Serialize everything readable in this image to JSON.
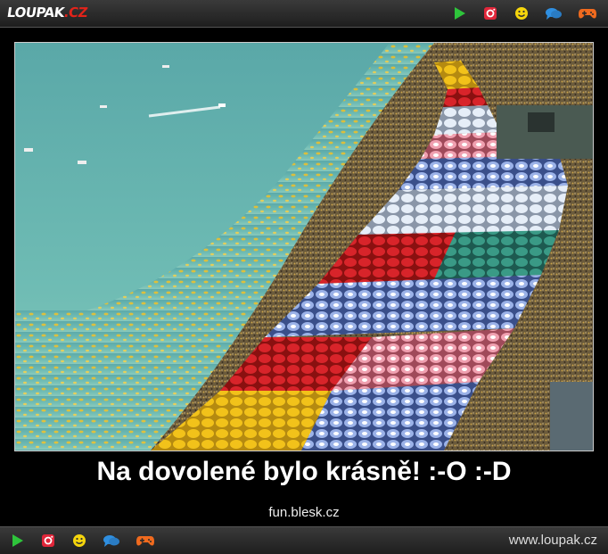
{
  "header": {
    "logo_main": "LOUPAK",
    "logo_suffix": ".CZ",
    "icons": [
      "play-icon",
      "instagram-icon",
      "smiley-icon",
      "chat-bubbles-icon",
      "gamepad-icon"
    ]
  },
  "content": {
    "caption": "Na dovolené bylo krásně! :-O :-D",
    "source": "fun.blesk.cz",
    "image_description": "aerial photo of a crowded beach with rows of colorful umbrellas"
  },
  "footer": {
    "site": "www.loupak.cz",
    "icons": [
      "play-icon",
      "instagram-icon",
      "smiley-icon",
      "chat-bubbles-icon",
      "gamepad-icon"
    ]
  },
  "colors": {
    "bar_bg": "#2b2b2b",
    "play": "#2ec43b",
    "instagram": "#e0263a",
    "smiley": "#f5d50c",
    "chat": "#2f8fe0",
    "gamepad": "#f06a1e",
    "logo_accent": "#e2231a"
  }
}
